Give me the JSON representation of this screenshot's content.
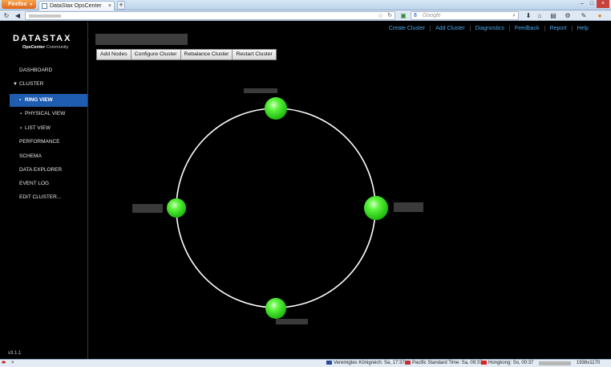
{
  "browser": {
    "menu_button": "Firefox",
    "tab_title": "DataStax OpsCenter",
    "search_placeholder": "Google",
    "search_engine_icon": "g-icon"
  },
  "app": {
    "logo_text": "DATASTAX",
    "logo_sub_bold": "OpsCenter",
    "logo_sub_rest": " Community",
    "version": "v3.1.1",
    "accent_color": "#1f5db0",
    "link_color": "#4ea5e8",
    "node_color": "#2ee81a"
  },
  "sidebar": {
    "items": [
      {
        "label": "DASHBOARD"
      },
      {
        "label": "CLUSTER"
      },
      {
        "label": "RING VIEW"
      },
      {
        "label": "PHYSICAL VIEW"
      },
      {
        "label": "LIST VIEW"
      },
      {
        "label": "PERFORMANCE"
      },
      {
        "label": "SCHEMA"
      },
      {
        "label": "DATA EXPLORER"
      },
      {
        "label": "EVENT LOG"
      },
      {
        "label": "EDIT CLUSTER..."
      }
    ]
  },
  "toplinks": [
    "Create Cluster",
    "Add Cluster",
    "Diagnostics",
    "Feedback",
    "Report",
    "Help"
  ],
  "buttons": [
    "Add Nodes",
    "Configure Cluster",
    "Rebalance Cluster",
    "Restart Cluster"
  ],
  "ring": {
    "node_count": 4
  },
  "statusbar": {
    "clock1": "Vereinigtes Königreich: Sa, 17:37",
    "clock2": "Pacific Standard Time: Sa, 09:37",
    "clock3": "Hongkong: So, 00:37",
    "resolution": "1938x1170"
  }
}
